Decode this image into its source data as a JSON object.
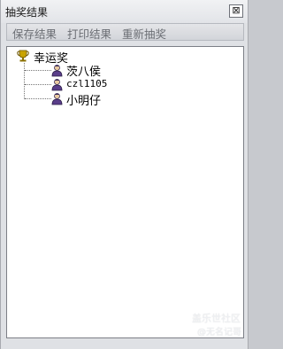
{
  "window": {
    "title": "抽奖结果",
    "close_glyph": "⊠"
  },
  "menu": {
    "items": [
      "保存结果",
      "打印结果",
      "重新抽奖"
    ]
  },
  "tree": {
    "root": {
      "label": "幸运奖",
      "icon": "trophy-icon"
    },
    "children": [
      {
        "label": "茨八侯",
        "icon": "person-icon"
      },
      {
        "label": "czl1105",
        "icon": "person-icon"
      },
      {
        "label": "小明仔",
        "icon": "person-icon"
      }
    ]
  },
  "watermark": {
    "line1": "盖乐世社区",
    "line2": "@无名记哥"
  },
  "colors": {
    "icon_purple": "#5a3e8a",
    "trophy_gold": "#c9a400",
    "menu_text": "#6b6e74"
  }
}
